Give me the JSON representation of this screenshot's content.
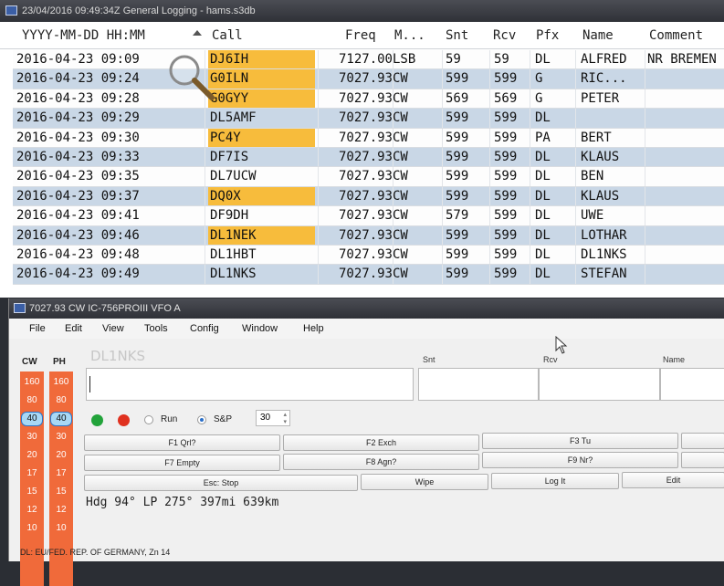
{
  "log_window": {
    "title": "23/04/2016 09:49:34Z  General Logging - hams.s3db",
    "columns": {
      "datetime": "YYYY-MM-DD HH:MM",
      "call": "Call",
      "freq": "Freq",
      "mode": "M...",
      "snt": "Snt",
      "rcv": "Rcv",
      "pfx": "Pfx",
      "name": "Name",
      "comment": "Comment"
    },
    "rows": [
      {
        "datetime": "2016-04-23 09:09",
        "call": "DJ6IH",
        "freq": "7127.00",
        "mode": "LSB",
        "snt": "59",
        "rcv": "59",
        "pfx": "DL",
        "name": "ALFRED",
        "comment": "NR BREMEN",
        "highlight": true
      },
      {
        "datetime": "2016-04-23 09:24",
        "call": "G0ILN",
        "freq": "7027.93",
        "mode": "CW",
        "snt": "599",
        "rcv": "599",
        "pfx": "G",
        "name": "RIC...",
        "comment": "",
        "highlight": true
      },
      {
        "datetime": "2016-04-23 09:28",
        "call": "G0GYY",
        "freq": "7027.93",
        "mode": "CW",
        "snt": "569",
        "rcv": "569",
        "pfx": "G",
        "name": "PETER",
        "comment": "",
        "highlight": true
      },
      {
        "datetime": "2016-04-23 09:29",
        "call": "DL5AMF",
        "freq": "7027.93",
        "mode": "CW",
        "snt": "599",
        "rcv": "599",
        "pfx": "DL",
        "name": "",
        "comment": "",
        "highlight": false
      },
      {
        "datetime": "2016-04-23 09:30",
        "call": "PC4Y",
        "freq": "7027.93",
        "mode": "CW",
        "snt": "599",
        "rcv": "599",
        "pfx": "PA",
        "name": "BERT",
        "comment": "",
        "highlight": true
      },
      {
        "datetime": "2016-04-23 09:33",
        "call": "DF7IS",
        "freq": "7027.93",
        "mode": "CW",
        "snt": "599",
        "rcv": "599",
        "pfx": "DL",
        "name": "KLAUS",
        "comment": "",
        "highlight": false
      },
      {
        "datetime": "2016-04-23 09:35",
        "call": "DL7UCW",
        "freq": "7027.93",
        "mode": "CW",
        "snt": "599",
        "rcv": "599",
        "pfx": "DL",
        "name": "BEN",
        "comment": "",
        "highlight": false
      },
      {
        "datetime": "2016-04-23 09:37",
        "call": "DQ0X",
        "freq": "7027.93",
        "mode": "CW",
        "snt": "599",
        "rcv": "599",
        "pfx": "DL",
        "name": "KLAUS",
        "comment": "",
        "highlight": true
      },
      {
        "datetime": "2016-04-23 09:41",
        "call": "DF9DH",
        "freq": "7027.93",
        "mode": "CW",
        "snt": "579",
        "rcv": "599",
        "pfx": "DL",
        "name": "UWE",
        "comment": "",
        "highlight": false
      },
      {
        "datetime": "2016-04-23 09:46",
        "call": "DL1NEK",
        "freq": "7027.93",
        "mode": "CW",
        "snt": "599",
        "rcv": "599",
        "pfx": "DL",
        "name": "LOTHAR",
        "comment": "",
        "highlight": true
      },
      {
        "datetime": "2016-04-23 09:48",
        "call": "DL1HBT",
        "freq": "7027.93",
        "mode": "CW",
        "snt": "599",
        "rcv": "599",
        "pfx": "DL",
        "name": "DL1NKS",
        "comment": "",
        "highlight": false
      },
      {
        "datetime": "2016-04-23 09:49",
        "call": "DL1NKS",
        "freq": "7027.93",
        "mode": "CW",
        "snt": "599",
        "rcv": "599",
        "pfx": "DL",
        "name": "STEFAN",
        "comment": "",
        "highlight": false
      }
    ],
    "colors": {
      "row_alt": "#c9d7e6",
      "call_highlight": "#f7bc3c"
    }
  },
  "entry_window": {
    "title": "7027.93 CW IC-756PROIII VFO A",
    "menu": [
      "File",
      "Edit",
      "View",
      "Tools",
      "Config",
      "Window",
      "Help"
    ],
    "band_headers": {
      "cw": "CW",
      "ph": "PH"
    },
    "bands": [
      "160",
      "80",
      "40",
      "30",
      "20",
      "17",
      "15",
      "12",
      "10"
    ],
    "active_band": "40",
    "call_value": "DL1NKS",
    "field_labels": {
      "snt": "Snt",
      "rcv": "Rcv",
      "name": "Name"
    },
    "run_label": "Run",
    "sp_label": "S&P",
    "spin_value": "30",
    "function_keys_row1": [
      "F1 Qrl?",
      "F2 Exch",
      "F3 Tu"
    ],
    "function_keys_row2": [
      "F7 Empty",
      "F8 Agn?",
      "F9 Nr?"
    ],
    "action_buttons": [
      "Esc: Stop",
      "Wipe",
      "Log It",
      "Edit"
    ],
    "bearing": "Hdg 94°  LP 275°  397mi  639km",
    "status": "DL: EU/FED. REP. OF GERMANY, Zn 14",
    "colors": {
      "band_bg": "#f06a3a",
      "led_green": "#22a33a",
      "led_red": "#e0311f"
    }
  }
}
